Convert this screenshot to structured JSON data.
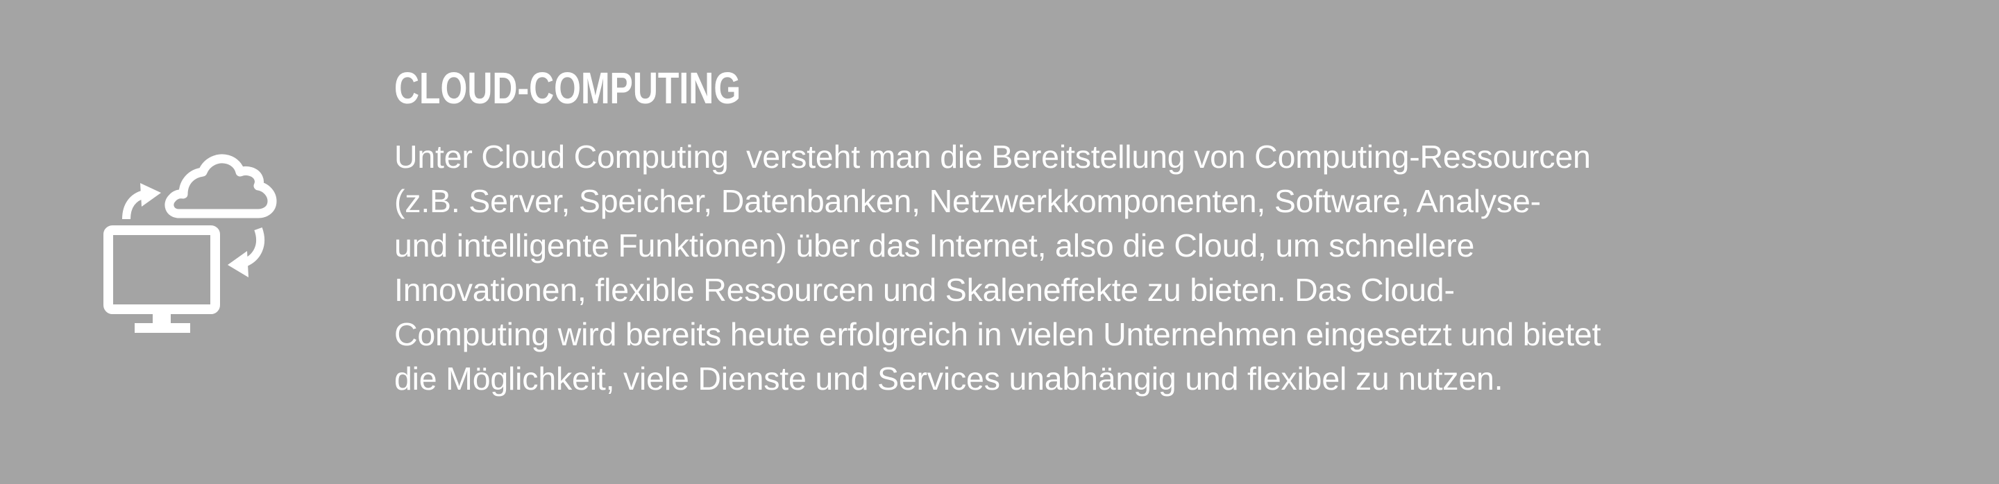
{
  "icon": {
    "name": "cloud-computer-sync-icon",
    "color": "#ffffff"
  },
  "colors": {
    "background": "#a4a4a4",
    "text": "#ffffff"
  },
  "section": {
    "title": "CLOUD-COMPUTING",
    "lines": [
      "Unter Cloud Computing  versteht man die Bereitstellung von Computing-Ressourcen",
      "(z.B. Server, Speicher, Datenbanken, Netzwerkkomponenten, Software, Analyse-",
      "und intelligente Funktionen) über das Internet, also die Cloud, um schnellere",
      "Innovationen, flexible Ressourcen und Skaleneffekte zu bieten. Das Cloud-",
      "Computing wird bereits heute erfolgreich in vielen Unternehmen eingesetzt und bietet",
      "die Möglichkeit, viele Dienste und Services unabhängig und flexibel zu nutzen."
    ]
  }
}
